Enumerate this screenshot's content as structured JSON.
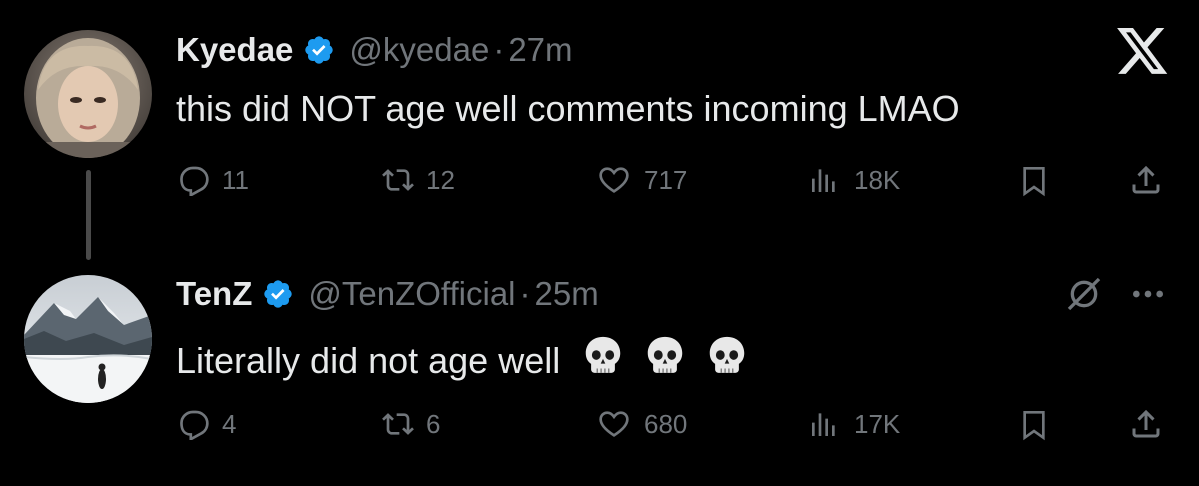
{
  "post": {
    "author_name": "Kyedae",
    "handle": "@kyedae",
    "sep": "·",
    "time": "27m",
    "text": "this did NOT age well comments incoming LMAO",
    "replies": "11",
    "reposts": "12",
    "likes": "717",
    "views": "18K"
  },
  "reply": {
    "author_name": "TenZ",
    "handle": "@TenZOfficial",
    "sep": "·",
    "time": "25m",
    "text": "Literally did not age well",
    "emoji": "💀",
    "replies": "4",
    "reposts": "6",
    "likes": "680",
    "views": "17K"
  },
  "colors": {
    "background": "#000000",
    "text": "#e7e9ea",
    "muted": "#71767b",
    "verified": "#1d9bf0"
  },
  "icons": [
    "x-logo-icon",
    "verified-badge-icon",
    "reply-icon",
    "repost-icon",
    "like-icon",
    "views-icon",
    "bookmark-icon",
    "share-icon",
    "grok-icon",
    "more-icon",
    "skull-emoji-icon"
  ]
}
